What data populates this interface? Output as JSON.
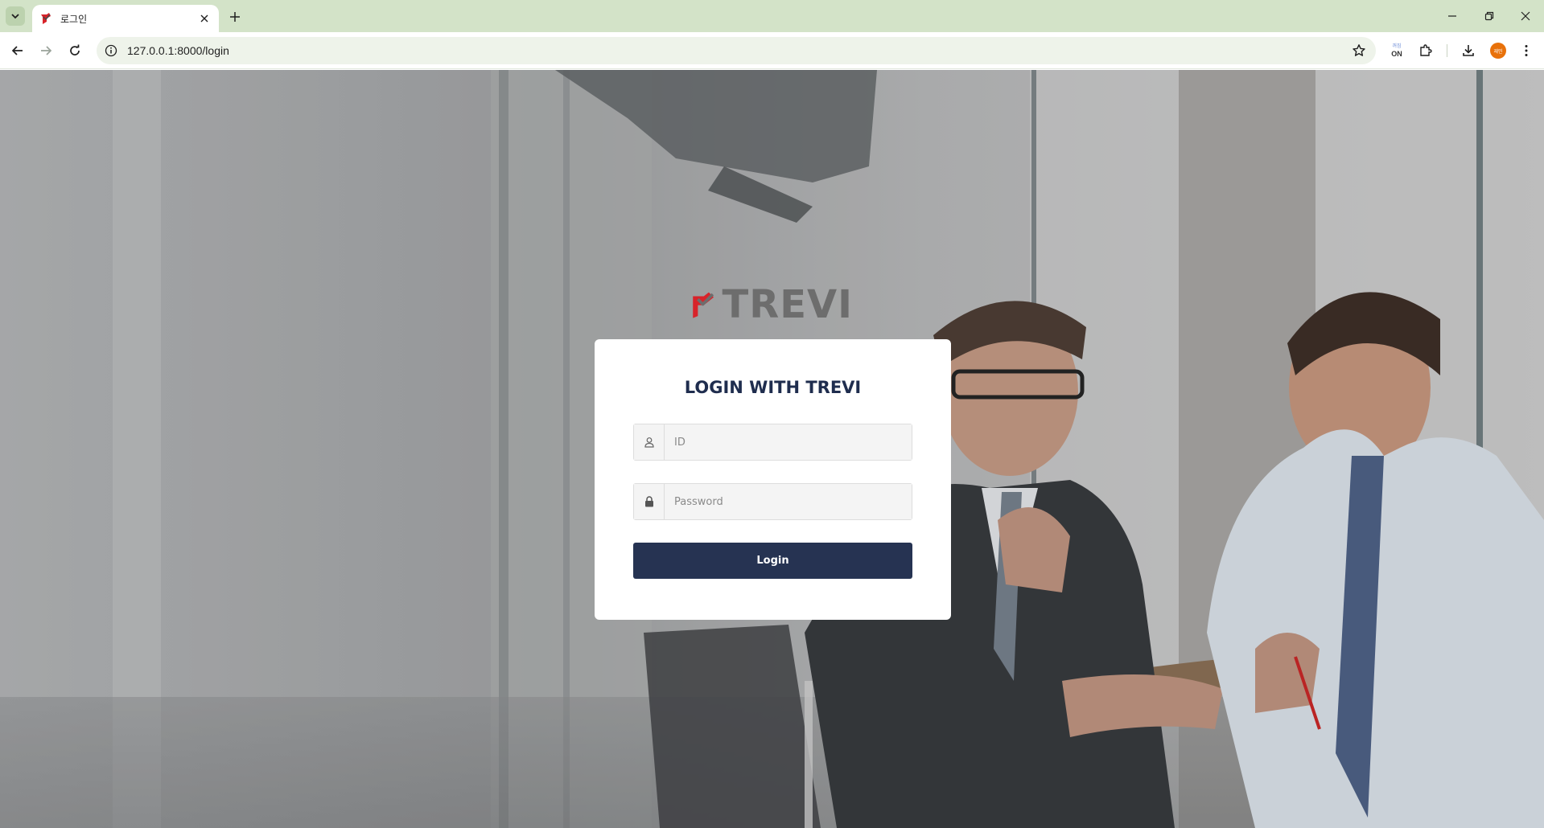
{
  "browser": {
    "tab_title": "로그인",
    "url": "127.0.0.1:8000/login",
    "extension_badge_top": "꺼짐",
    "extension_badge": "ON",
    "profile_initials": "재민"
  },
  "page": {
    "logo_text": "TREVI",
    "login_title": "LOGIN WITH TREVI",
    "id_placeholder": "ID",
    "password_placeholder": "Password",
    "login_button": "Login"
  },
  "colors": {
    "tabstrip": "#d3e3c8",
    "title_navy": "#1f2d4e",
    "button_navy": "#263352",
    "logo_red": "#d8232a",
    "logo_gray": "#6d6d6d"
  }
}
